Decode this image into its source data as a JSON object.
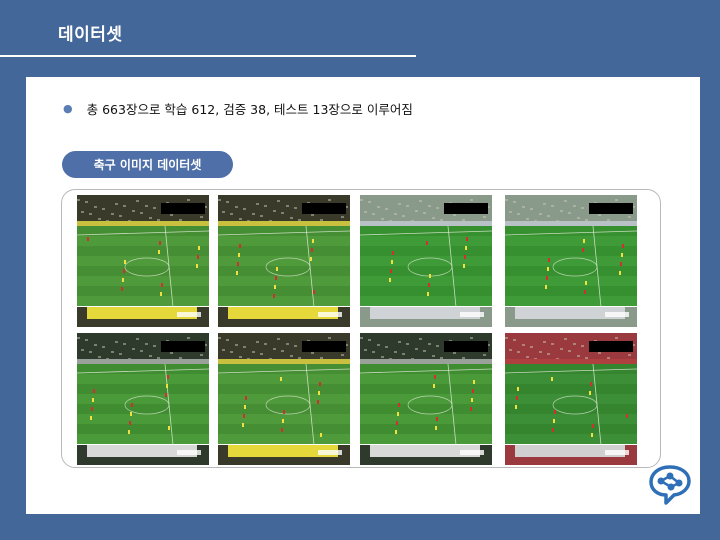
{
  "slide": {
    "title": "데이터셋",
    "bullet": "총 663장으로 학습 612, 검증 38, 테스트 13장으로 이루어짐",
    "pill_label": "축구 이미지 데이터셋"
  },
  "thumbnails": [
    {
      "variant": "dortmund-day"
    },
    {
      "variant": "dortmund-day"
    },
    {
      "variant": "bright-stadium"
    },
    {
      "variant": "bright-stadium"
    },
    {
      "variant": "dark-stadium"
    },
    {
      "variant": "dortmund-day"
    },
    {
      "variant": "dark-stadium"
    },
    {
      "variant": "red-stands"
    }
  ],
  "colors": {
    "background": "#44679a",
    "panel": "#ffffff",
    "pill": "#4f6fa8",
    "logo": "#2f6fb8"
  },
  "icons": {
    "logo": "network-brain-icon"
  }
}
